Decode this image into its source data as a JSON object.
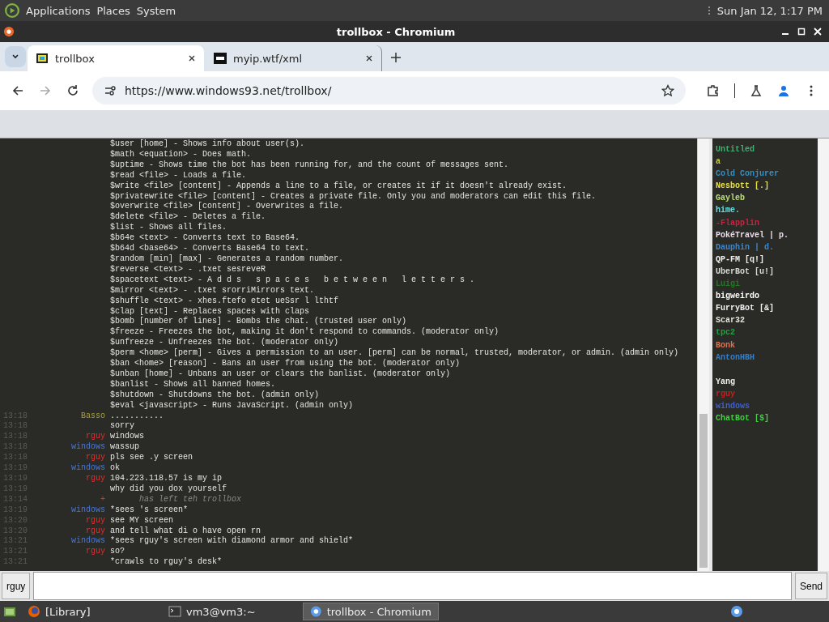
{
  "top_panel": {
    "menus": [
      "Applications",
      "Places",
      "System"
    ],
    "clock": "Sun Jan 12, 1:17 PM"
  },
  "window": {
    "title": "trollbox - Chromium"
  },
  "tabs": [
    {
      "label": "trollbox",
      "selected": true
    },
    {
      "label": "myip.wtf/xml",
      "selected": false
    }
  ],
  "address_bar": {
    "url": "https://www.windows93.net/trollbox/"
  },
  "help_lines": [
    "$user [home] - Shows info about user(s).",
    "$math <equation> - Does math.",
    "$uptime - Shows time the bot has been running for, and the count of messages sent.",
    "$read <file> - Loads a file.",
    "$write <file> [content] - Appends a line to a file, or creates it if it doesn't already exist.",
    "$privatewrite <file> [content] - Creates a private file. Only you and moderators can edit this file.",
    "$overwrite <file> [content] - Overwrites a file.",
    "$delete <file> - Deletes a file.",
    "$list - Shows all files.",
    "$b64e <text> - Converts text to Base64.",
    "$b64d <base64> - Converts Base64 to text.",
    "$random [min] [max] - Generates a random number.",
    "$reverse <text> - .txet sesreveR",
    "$spacetext <text> - A d d s   s p a c e s   b e t w e e n   l e t t e r s .",
    "$mirror <text> - .txet srorriMirrors text.",
    "$shuffle <text> - xhes.ftefo etet ueSsr l lthtf",
    "$clap [text] - Replaces spaces with claps",
    "$bomb [number of lines] - Bombs the chat. (trusted user only)",
    "$freeze - Freezes the bot, making it don't respond to commands. (moderator only)",
    "$unfreeze - Unfreezes the bot. (moderator only)",
    "$perm <home> [perm] - Gives a permission to an user. [perm] can be normal, trusted, moderator, or admin. (admin only)",
    "$ban <home> [reason] - Bans an user from using the bot. (moderator only)",
    "$unban [home] - Unbans an user or clears the banlist. (moderator only)",
    "$banlist - Shows all banned homes.",
    "$shutdown - Shutdowns the bot. (admin only)",
    "$eval <javascript> - Runs JavaScript. (admin only)"
  ],
  "messages": [
    {
      "time": "13:18",
      "nick": "Basso",
      "color": "#a8a040",
      "text": "...........",
      "kind": "message"
    },
    {
      "time": "13:18",
      "text": "sorry",
      "kind": "message"
    },
    {
      "time": "13:18",
      "nick": "rguy",
      "color": "#e03030",
      "text": "windows",
      "kind": "message"
    },
    {
      "time": "13:18",
      "nick": "windows",
      "color": "#4a78d8",
      "text": "wassup",
      "kind": "message"
    },
    {
      "time": "13:18",
      "nick": "rguy",
      "color": "#e03030",
      "text": "pls see .y screen",
      "kind": "message"
    },
    {
      "time": "13:19",
      "nick": "windows",
      "color": "#4a78d8",
      "text": "ok",
      "kind": "message"
    },
    {
      "time": "13:19",
      "nick": "rguy",
      "color": "#e03030",
      "text": "104.223.118.57 is my ip",
      "kind": "message"
    },
    {
      "time": "13:19",
      "text": "why did you dox yourself",
      "kind": "message"
    },
    {
      "time": "13:14",
      "nick": "+",
      "color": "#e03030",
      "text": "has left teh trollbox",
      "kind": "system"
    },
    {
      "time": "13:19",
      "nick": "windows",
      "color": "#4a78d8",
      "text": "*sees 's screen*",
      "kind": "message"
    },
    {
      "time": "13:20",
      "nick": "rguy",
      "color": "#e03030",
      "text": "see MY screen",
      "kind": "message"
    },
    {
      "time": "13:20",
      "nick": "rguy",
      "color": "#e03030",
      "text": "and tell what di o have open rn",
      "kind": "message"
    },
    {
      "time": "13:21",
      "nick": "windows",
      "color": "#4a78d8",
      "text": "*sees rguy's screen with diamond armor and shield*",
      "kind": "message"
    },
    {
      "time": "13:21",
      "nick": "rguy",
      "color": "#e03030",
      "text": "so?",
      "kind": "message"
    },
    {
      "time": "13:21",
      "text": "*crawls to rguy's desk*",
      "kind": "message"
    }
  ],
  "users": [
    {
      "name": "Untitled",
      "color": "#40b070"
    },
    {
      "name": "a",
      "color": "#c8d040"
    },
    {
      "name": "Cold Conjurer",
      "color": "#3090c8"
    },
    {
      "name": "Nesbott [.]",
      "color": "#e8e040"
    },
    {
      "name": "Gayleb",
      "color": "#b8e070"
    },
    {
      "name": "hime.",
      "color": "#60e0e0"
    },
    {
      "name": "-Flapplin",
      "color": "#d02040"
    },
    {
      "name": "PokéTravel | p.",
      "color": "#ecdcec"
    },
    {
      "name": "Dauphin | d.",
      "color": "#3a88d0"
    },
    {
      "name": "QP-FM [q!]",
      "color": "#f0f0f0"
    },
    {
      "name": "UberBot [u!]",
      "color": "#d8d8d8"
    },
    {
      "name": "Luigi",
      "color": "#207a20"
    },
    {
      "name": "bigweirdo",
      "color": "#ffffff"
    },
    {
      "name": "FurryBot [&]",
      "color": "#f0f0f0"
    },
    {
      "name": "Scar32",
      "color": "#e4e4d8"
    },
    {
      "name": "tpc2",
      "color": "#20a040"
    },
    {
      "name": "Bonk",
      "color": "#e07050"
    },
    {
      "name": "AntonHBH",
      "color": "#3080d0"
    }
  ],
  "users_2": [
    {
      "name": "Yang",
      "color": "#f0f0f0"
    },
    {
      "name": "rguy",
      "color": "#c02020"
    },
    {
      "name": "windows",
      "color": "#4060c8"
    },
    {
      "name": "ChatBot [$]",
      "color": "#40d040"
    }
  ],
  "composer": {
    "nick": "rguy",
    "send": "Send"
  },
  "taskbar": [
    {
      "label": "[Library]",
      "selected": false
    },
    {
      "label": "vm3@vm3:~",
      "selected": false
    },
    {
      "label": "trollbox - Chromium",
      "selected": true
    }
  ]
}
